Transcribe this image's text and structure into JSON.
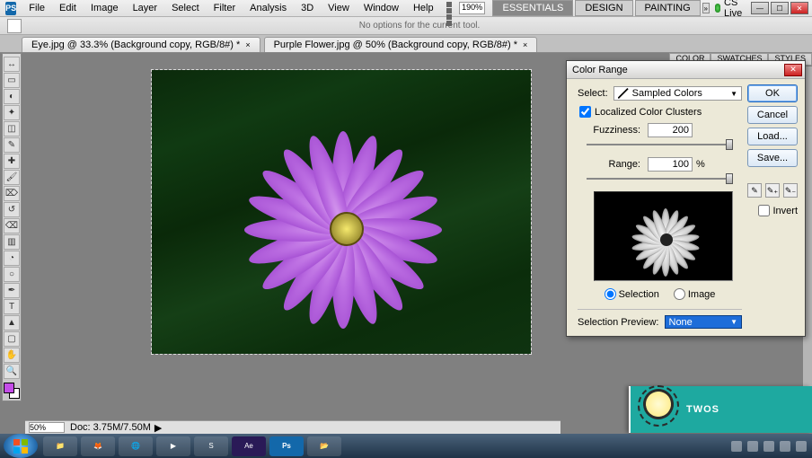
{
  "app_logo": "PS",
  "menu": [
    "File",
    "Edit",
    "Image",
    "Layer",
    "Select",
    "Filter",
    "Analysis",
    "3D",
    "View",
    "Window",
    "Help"
  ],
  "top_zoom_combo": "190%",
  "workspace_buttons": {
    "active": "ESSENTIALS",
    "others": [
      "DESIGN",
      "PAINTING"
    ]
  },
  "cslive": "CS Live",
  "options_bar_msg": "No options for the current tool.",
  "tabs": [
    {
      "label": "Eye.jpg @ 33.3% (Background copy, RGB/8#) *",
      "active": false
    },
    {
      "label": "Purple Flower.jpg @ 50% (Background copy, RGB/8#) *",
      "active": true
    }
  ],
  "status": {
    "zoom": "50%",
    "doc": "Doc: 3.75M/7.50M"
  },
  "right_panel_tabs": [
    "COLOR",
    "SWATCHES",
    "STYLES"
  ],
  "dialog": {
    "title": "Color Range",
    "select_label": "Select:",
    "select_value": "Sampled Colors",
    "localized": "Localized Color Clusters",
    "localized_checked": true,
    "fuzziness_label": "Fuzziness:",
    "fuzziness_value": "200",
    "range_label": "Range:",
    "range_value": "100",
    "range_unit": "%",
    "radio_selection": "Selection",
    "radio_image": "Image",
    "selection_preview_label": "Selection Preview:",
    "selection_preview_value": "None",
    "buttons": {
      "ok": "OK",
      "cancel": "Cancel",
      "load": "Load...",
      "save": "Save..."
    },
    "invert": "Invert"
  },
  "watermark": "TWOS"
}
